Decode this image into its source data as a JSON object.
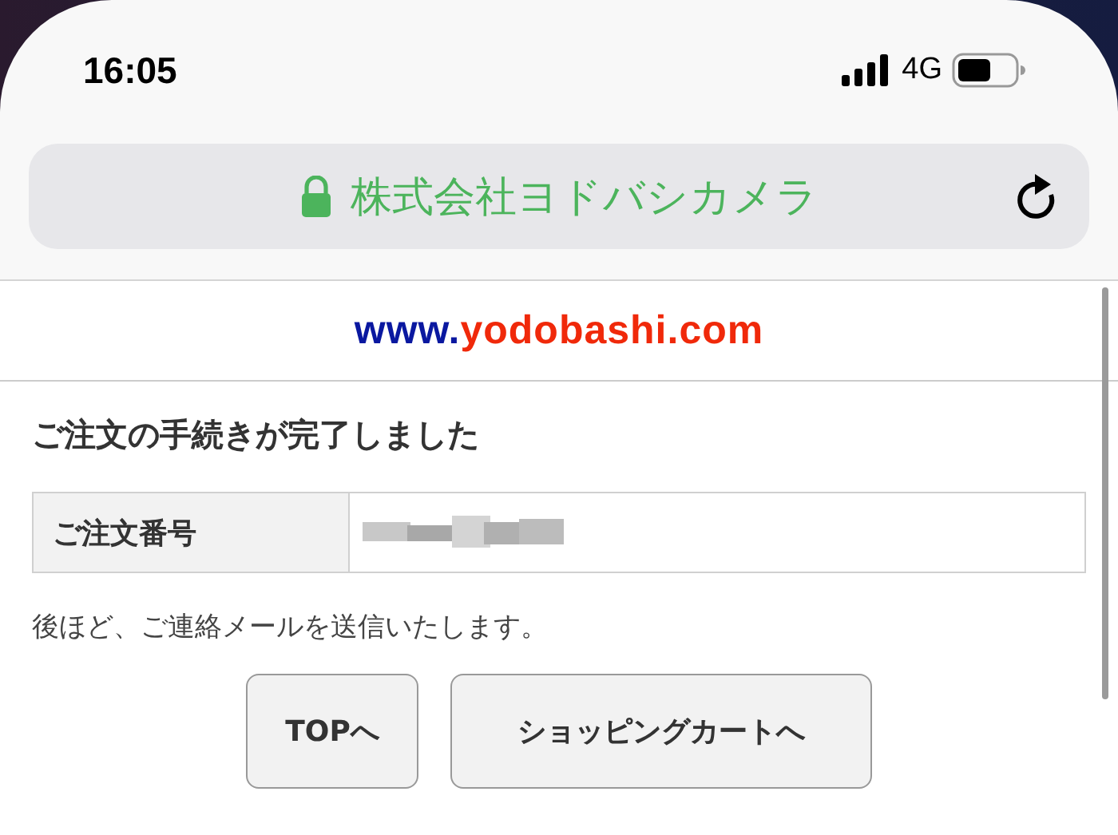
{
  "status_bar": {
    "time": "16:05",
    "network": "4G"
  },
  "address_bar": {
    "site": "株式会社ヨドバシカメラ",
    "secure": true
  },
  "logo": {
    "prefix": "www.",
    "name": "yodobashi.com"
  },
  "heading": "ご注文の手続きが完了しました",
  "order_table": {
    "label": "ご注文番号",
    "value_blurred": true
  },
  "message": "後ほど、ご連絡メールを送信いたします。",
  "buttons": [
    "TOPへ",
    "ショッピングカートへ"
  ]
}
